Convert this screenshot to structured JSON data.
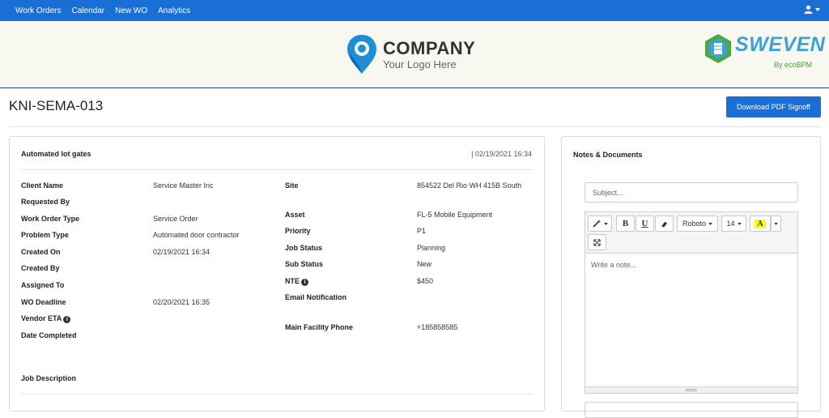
{
  "nav": {
    "items": [
      "Work Orders",
      "Calendar",
      "New WO",
      "Analytics"
    ],
    "user_icon": "user-icon"
  },
  "banner": {
    "company_name": "COMPANY",
    "company_tagline": "Your Logo Here",
    "sweven_name": "SWEVEN",
    "sweven_by": "By ecoBPM"
  },
  "page": {
    "title": "KNI-SEMA-013",
    "pdf_button": "Download PDF Signoff"
  },
  "work_order": {
    "title": "Automated lot gates",
    "date": "| 02/19/2021 16:34",
    "left_fields": [
      {
        "label": "Client Name",
        "value": "Service Master Inc"
      },
      {
        "label": "Requested By",
        "value": ""
      },
      {
        "label": "Work Order Type",
        "value": "Service Order"
      },
      {
        "label": "Problem Type",
        "value": "Automated door contractor"
      },
      {
        "label": "Created On",
        "value": "02/19/2021 16:34"
      },
      {
        "label": "Created By",
        "value": ""
      },
      {
        "label": "Assigned To",
        "value": ""
      },
      {
        "label": "WO Deadline",
        "value": "02/20/2021 16:35"
      },
      {
        "label": "Vendor ETA",
        "value": ""
      },
      {
        "label": "Date Completed",
        "value": ""
      }
    ],
    "right_fields": [
      {
        "label": "Site",
        "value": "854522 Del Rio WH 415B South"
      },
      {
        "label": "Asset",
        "value": "FL-5 Mobile Equipment"
      },
      {
        "label": "Priority",
        "value": "P1"
      },
      {
        "label": "Job Status",
        "value": "Planning"
      },
      {
        "label": "Sub Status",
        "value": "New"
      },
      {
        "label": "NTE",
        "value": "$450"
      },
      {
        "label": "Email Notification",
        "value": ""
      },
      {
        "label": "Main Facility Phone",
        "value": "+185858585"
      }
    ],
    "job_description_label": "Job Description"
  },
  "notes": {
    "title": "Notes & Documents",
    "subject_placeholder": "Subject...",
    "note_placeholder": "Write a note...",
    "toolbar": {
      "bold": "B",
      "underline": "U",
      "font": "Roboto",
      "size": "14",
      "highlight": "A"
    }
  },
  "colors": {
    "primary": "#1a6fd6",
    "banner_bg": "#f8f8f1",
    "highlight_yellow": "#ffff00"
  }
}
